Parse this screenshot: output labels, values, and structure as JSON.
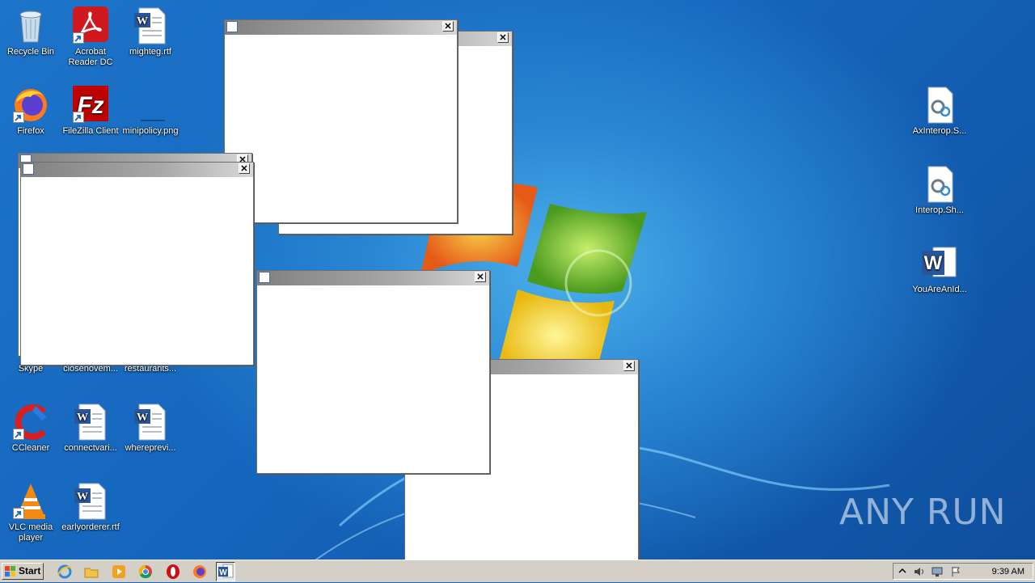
{
  "desktop": {
    "icons": [
      {
        "label": "Recycle Bin",
        "icon": "recycle-bin-icon"
      },
      {
        "label": "Acrobat Reader DC",
        "icon": "acrobat-icon"
      },
      {
        "label": "mighteg.rtf",
        "icon": "word-document-icon"
      },
      {
        "label": "Firefox",
        "icon": "firefox-icon"
      },
      {
        "label": "FileZilla Client",
        "icon": "filezilla-icon"
      },
      {
        "label": "minipolicy.png",
        "icon": "image-file-icon"
      },
      {
        "label": "Skype",
        "icon": "skype-icon"
      },
      {
        "label": "closenovem...",
        "icon": "document-icon"
      },
      {
        "label": "restaurants...",
        "icon": "document-icon"
      },
      {
        "label": "CCleaner",
        "icon": "ccleaner-icon"
      },
      {
        "label": "connectvari...",
        "icon": "word-document-icon"
      },
      {
        "label": "whereprevi...",
        "icon": "word-document-icon"
      },
      {
        "label": "VLC media player",
        "icon": "vlc-icon"
      },
      {
        "label": "earlyorderer.rtf",
        "icon": "word-document-icon"
      },
      {
        "label": "AxInterop.S...",
        "icon": "config-file-icon"
      },
      {
        "label": "Interop.Sh...",
        "icon": "config-file-icon"
      },
      {
        "label": "YouAreAnId...",
        "icon": "word-app-icon"
      }
    ]
  },
  "windows": {
    "close_glyph": "✕"
  },
  "taskbar": {
    "start_label": "Start",
    "pinned": [
      "internet-explorer-icon",
      "explorer-folder-icon",
      "media-player-icon",
      "chrome-icon",
      "opera-icon",
      "firefox-icon",
      "word-icon"
    ],
    "clock": "9:39 AM"
  },
  "watermark": "ANY RUN",
  "colors": {
    "taskbar": "#d4d0c8",
    "desktop": "#1a66b8",
    "titlebar_dark": "#808080",
    "titlebar_light": "#d8d8d8"
  }
}
